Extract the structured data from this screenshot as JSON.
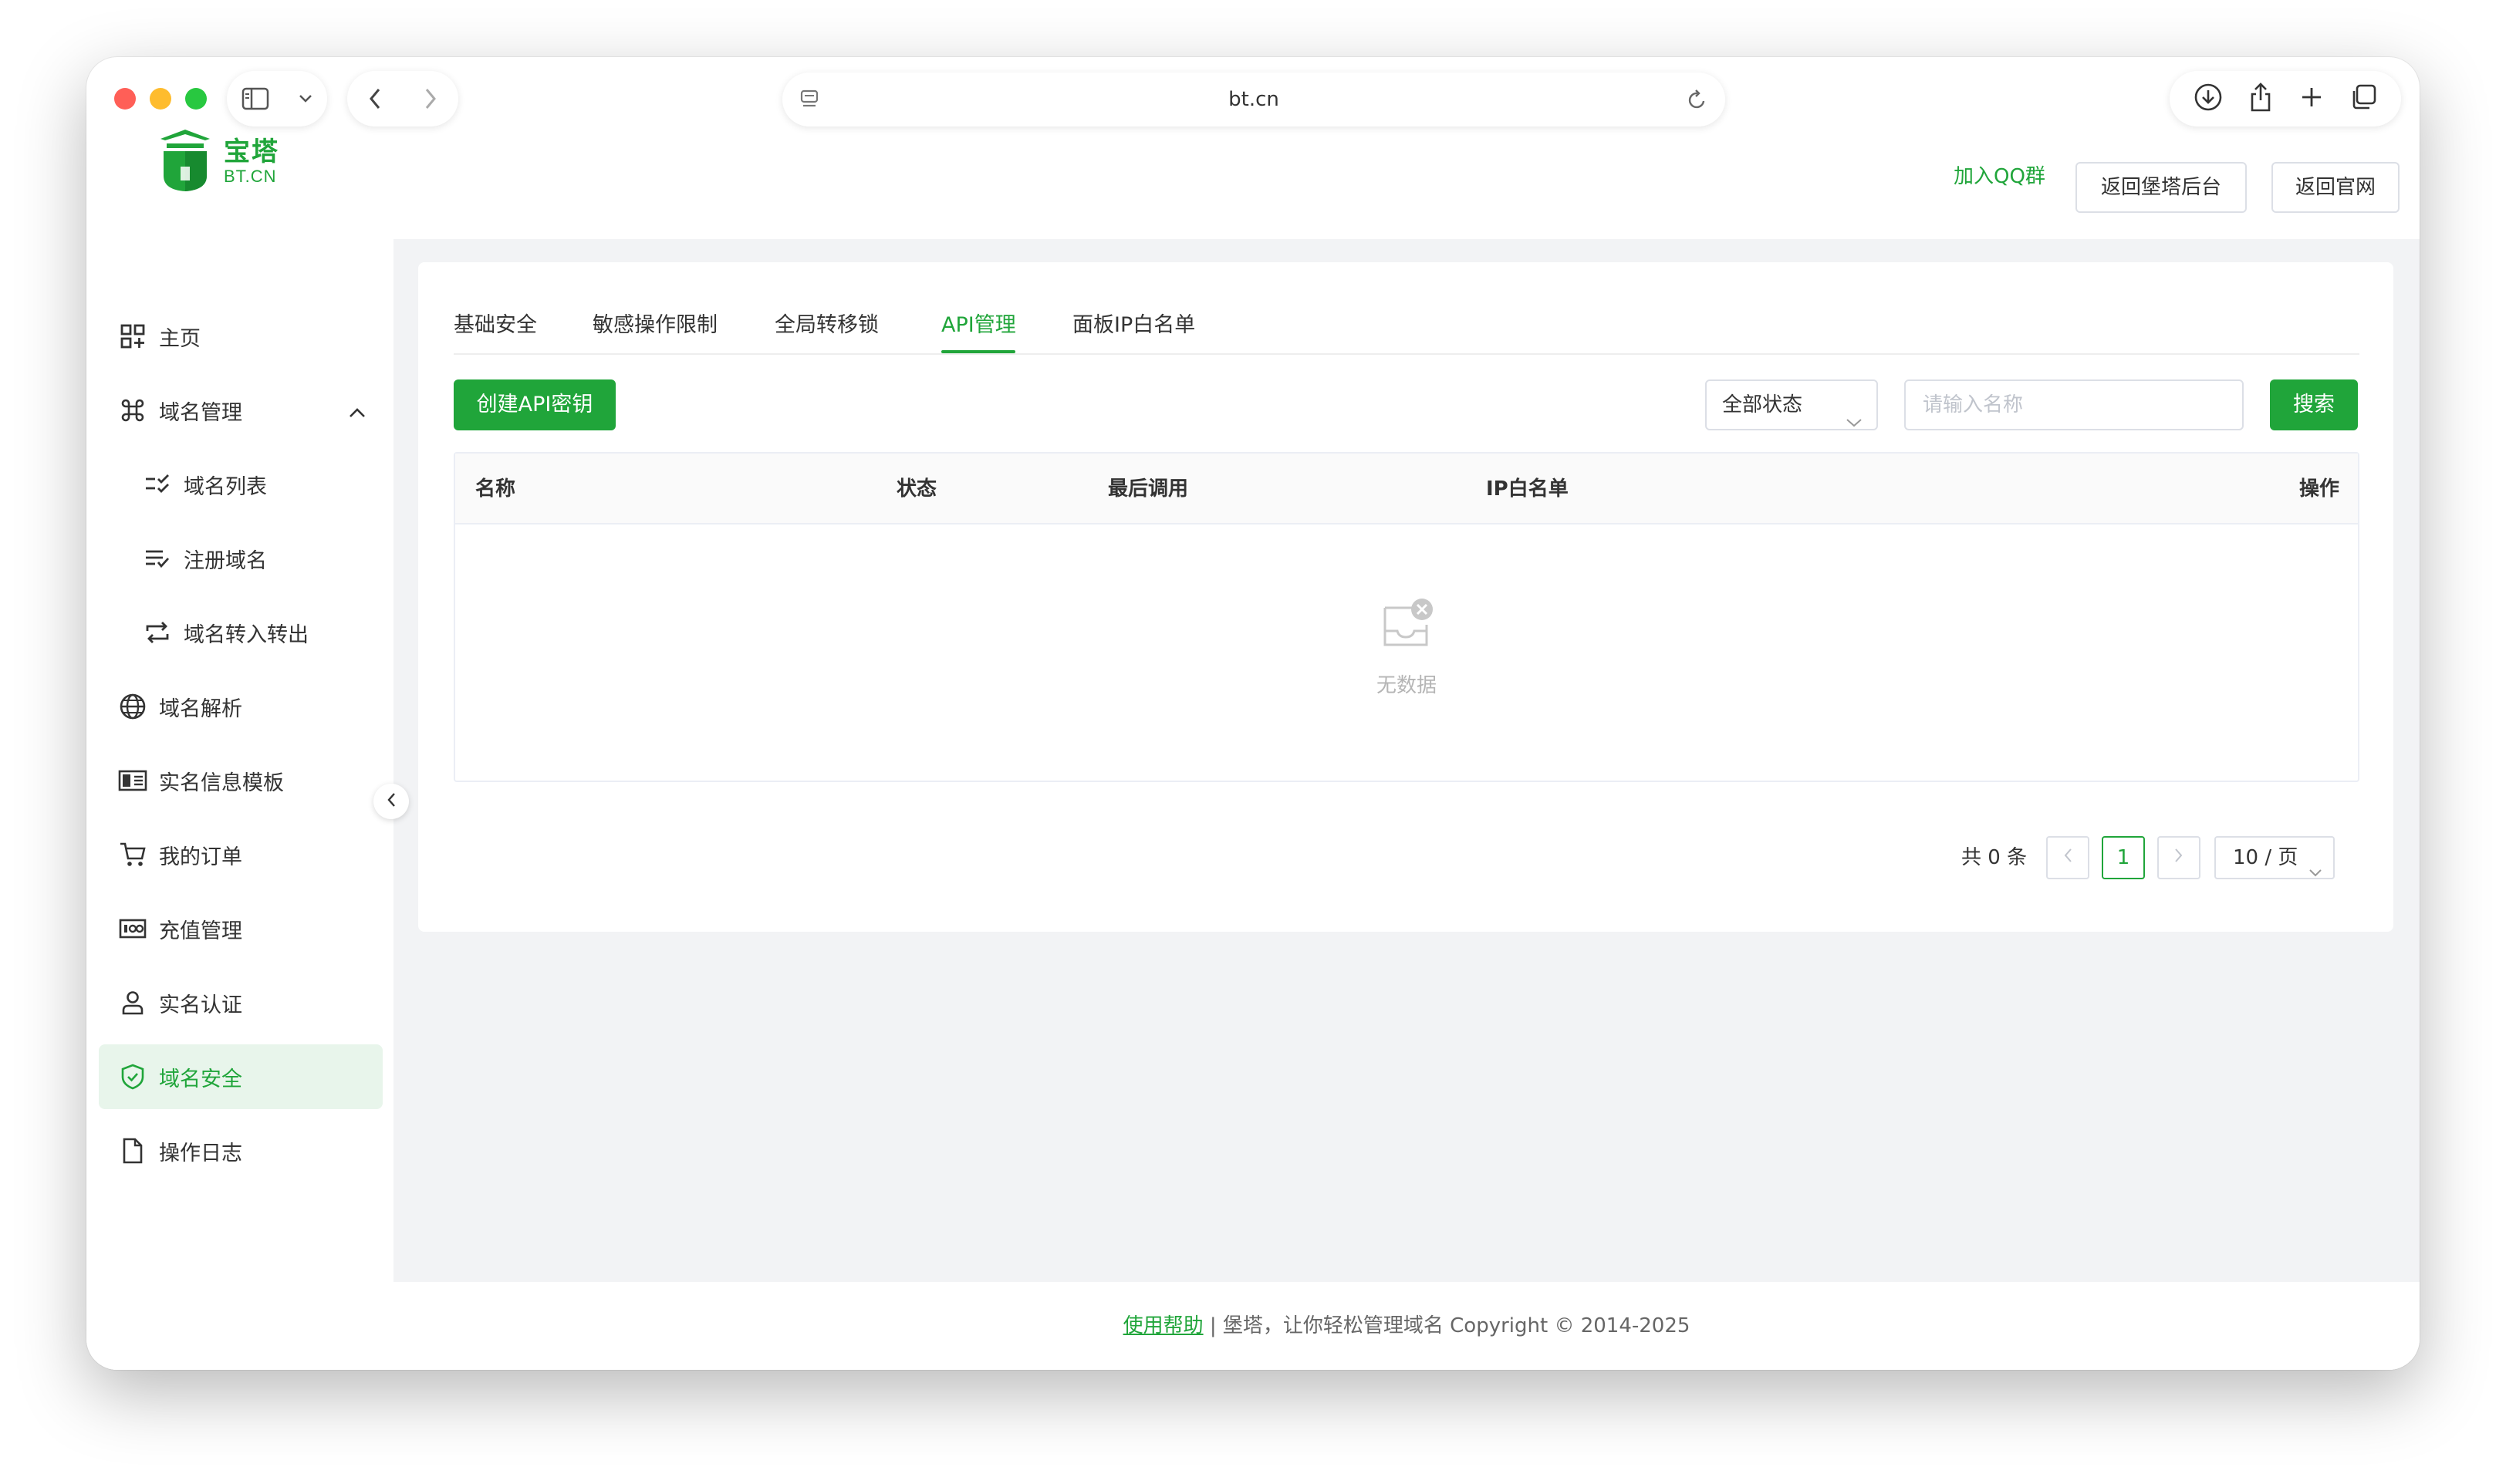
{
  "browser": {
    "url": "bt.cn"
  },
  "logo": {
    "cn": "宝塔",
    "en": "BT.CN"
  },
  "header": {
    "qq_link": "加入QQ群",
    "back_panel": "返回堡塔后台",
    "back_site": "返回官网"
  },
  "sidebar": {
    "items": [
      {
        "label": "主页",
        "icon": "dashboard-icon"
      },
      {
        "label": "域名管理",
        "icon": "command-icon"
      },
      {
        "label": "域名列表",
        "icon": "list-check-icon"
      },
      {
        "label": "注册域名",
        "icon": "list-add-icon"
      },
      {
        "label": "域名转入转出",
        "icon": "transfer-icon"
      },
      {
        "label": "域名解析",
        "icon": "globe-icon"
      },
      {
        "label": "实名信息模板",
        "icon": "id-card-icon"
      },
      {
        "label": "我的订单",
        "icon": "cart-icon"
      },
      {
        "label": "充值管理",
        "icon": "wallet-icon"
      },
      {
        "label": "实名认证",
        "icon": "user-icon"
      },
      {
        "label": "域名安全",
        "icon": "shield-icon"
      },
      {
        "label": "操作日志",
        "icon": "file-icon"
      }
    ],
    "active": "域名安全"
  },
  "tabs": [
    {
      "label": "基础安全"
    },
    {
      "label": "敏感操作限制"
    },
    {
      "label": "全局转移锁"
    },
    {
      "label": "API管理"
    },
    {
      "label": "面板IP白名单"
    }
  ],
  "active_tab": "API管理",
  "toolbar": {
    "create_label": "创建API密钥",
    "status_select": "全部状态",
    "search_placeholder": "请输入名称",
    "search_label": "搜索"
  },
  "table": {
    "columns": [
      "名称",
      "状态",
      "最后调用",
      "IP白名单",
      "操作"
    ],
    "empty_text": "无数据"
  },
  "pagination": {
    "total": "共 0 条",
    "current_page": "1",
    "page_size": "10 / 页"
  },
  "footer": {
    "help": "使用帮助",
    "text": " | 堡塔，让你轻松管理域名 Copyright © 2014-2025"
  },
  "colors": {
    "brand": "#20a53a",
    "active_bg": "#e8f5eb",
    "main_bg": "#f2f3f5"
  }
}
